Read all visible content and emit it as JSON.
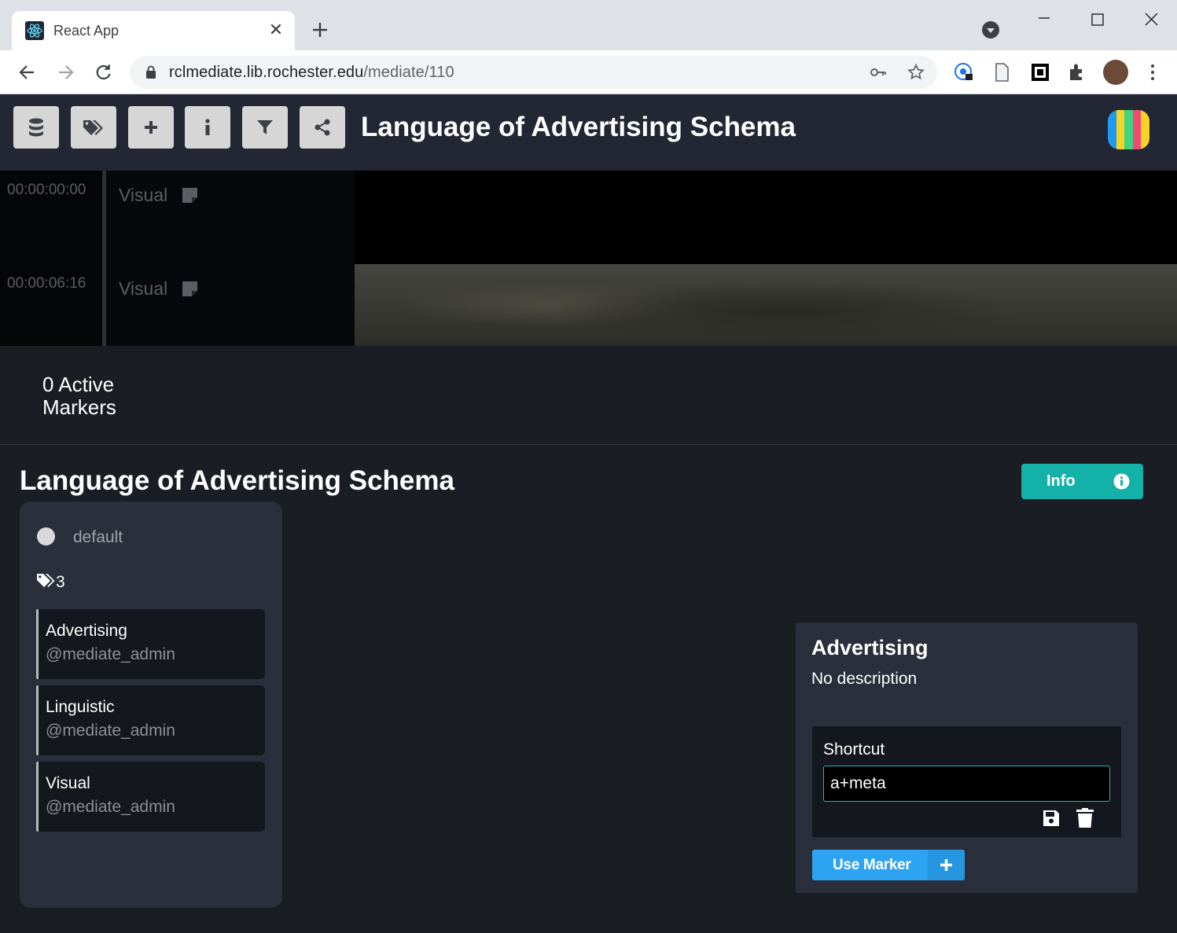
{
  "browser": {
    "tab_title": "React App",
    "url_host": "rclmediate.lib.rochester.edu",
    "url_path": "/mediate/110"
  },
  "header": {
    "title": "Language of Advertising Schema",
    "buttons": [
      "database-icon",
      "tags-icon",
      "plus-icon",
      "info-icon",
      "filter-icon",
      "share-icon"
    ],
    "logo_colors": [
      "#1e9bf0",
      "#f6d325",
      "#3ed37e",
      "#f24a73",
      "#f6d325"
    ]
  },
  "timeline": {
    "rows": [
      {
        "time": "00:00:00:00",
        "label": "Visual"
      },
      {
        "time": "00:00:06:16",
        "label": "Visual"
      }
    ]
  },
  "markers": {
    "active_text": "0 Active Markers"
  },
  "schema": {
    "title": "Language of Advertising Schema",
    "info_label": "Info",
    "default_label": "default",
    "tag_count": "3",
    "tags": [
      {
        "name": "Advertising",
        "user": "@mediate_admin"
      },
      {
        "name": "Linguistic",
        "user": "@mediate_admin"
      },
      {
        "name": "Visual",
        "user": "@mediate_admin"
      }
    ]
  },
  "detail": {
    "title": "Advertising",
    "description": "No description",
    "shortcut_label": "Shortcut",
    "shortcut_value": "a+meta",
    "use_marker_label": "Use Marker"
  },
  "colors": {
    "accent_teal": "#14b1a8",
    "accent_blue": "#2ea3f2",
    "header_bg": "#222733",
    "page_bg": "#1a1d24"
  }
}
